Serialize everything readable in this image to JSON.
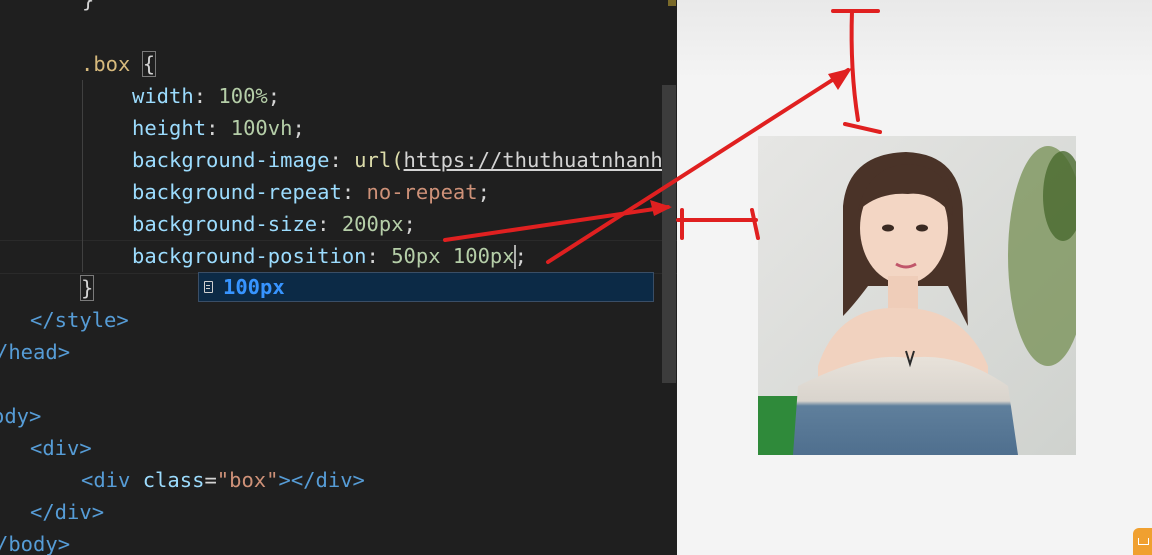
{
  "code": {
    "line0": "}",
    "selector": ".box",
    "open_brace": "{",
    "width_prop": "width",
    "width_val": "100%",
    "height_prop": "height",
    "height_val": "100vh",
    "bgimg_prop": "background-image",
    "bgimg_fn": "url(",
    "bgimg_url": "https://thuthuatnhanh",
    "bgrepeat_prop": "background-repeat",
    "bgrepeat_val": "no-repeat",
    "bgsize_prop": "background-size",
    "bgsize_val": "200px",
    "bgpos_prop": "background-position",
    "bgpos_val_a": "50px",
    "bgpos_val_b": "100px",
    "close_brace": "}",
    "style_close": "</style>",
    "head_close": "/head>",
    "body_open": "ody>",
    "div_open": "<div>",
    "inner_div_open": "<div",
    "inner_div_attr": "class",
    "inner_div_val": "\"box\"",
    "inner_div_close": "></div>",
    "div_close": "</div>",
    "body_close": "/body>"
  },
  "suggestion": {
    "label": "100px",
    "icon": "snippet-icon"
  },
  "preview": {
    "image_icon": "portrait-photo"
  },
  "colors": {
    "editor_bg": "#1f1f1f",
    "selector": "#d7ba7d",
    "property": "#9cdcfe",
    "number": "#b5cea8",
    "string": "#ce9178",
    "tag": "#569cd6",
    "suggest_text": "#3794ff",
    "annotation": "#e02020"
  }
}
